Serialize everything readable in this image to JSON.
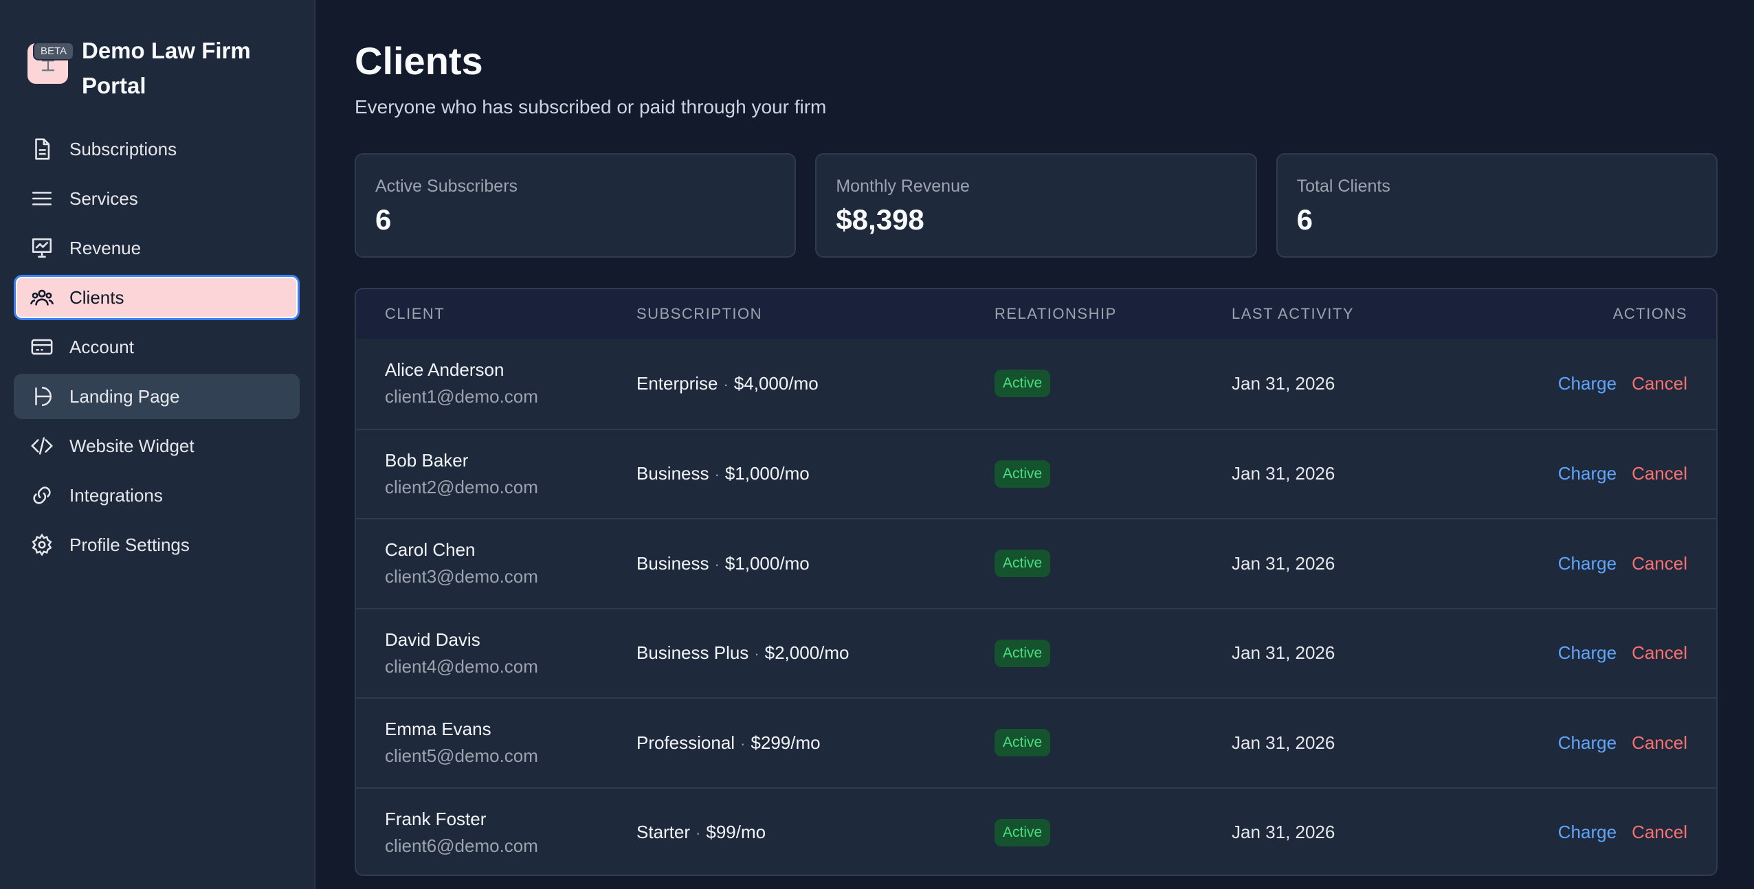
{
  "brand": {
    "title": "Demo Law Firm Portal",
    "badge": "BETA",
    "logo_icon": "scale-icon"
  },
  "sidebar": {
    "items": [
      {
        "label": "Subscriptions",
        "icon": "document-icon"
      },
      {
        "label": "Services",
        "icon": "list-icon"
      },
      {
        "label": "Revenue",
        "icon": "chart-presentation-icon"
      },
      {
        "label": "Clients",
        "icon": "users-icon",
        "active": true
      },
      {
        "label": "Account",
        "icon": "credit-card-icon"
      },
      {
        "label": "Landing Page",
        "icon": "landing-icon",
        "hover": true
      },
      {
        "label": "Website Widget",
        "icon": "code-icon"
      },
      {
        "label": "Integrations",
        "icon": "link-icon"
      },
      {
        "label": "Profile Settings",
        "icon": "gear-icon"
      }
    ]
  },
  "header": {
    "title": "Clients",
    "subtitle": "Everyone who has subscribed or paid through your firm"
  },
  "stats": [
    {
      "label": "Active Subscribers",
      "value": "6"
    },
    {
      "label": "Monthly Revenue",
      "value": "$8,398"
    },
    {
      "label": "Total Clients",
      "value": "6"
    }
  ],
  "table": {
    "columns": [
      "CLIENT",
      "SUBSCRIPTION",
      "RELATIONSHIP",
      "LAST ACTIVITY",
      "ACTIONS"
    ],
    "rows": [
      {
        "name": "Alice Anderson",
        "email": "client1@demo.com",
        "plan": "Enterprise",
        "price": "$4,000/mo",
        "status": "Active",
        "last_activity": "Jan 31, 2026",
        "charge": "Charge",
        "cancel": "Cancel"
      },
      {
        "name": "Bob Baker",
        "email": "client2@demo.com",
        "plan": "Business",
        "price": "$1,000/mo",
        "status": "Active",
        "last_activity": "Jan 31, 2026",
        "charge": "Charge",
        "cancel": "Cancel"
      },
      {
        "name": "Carol Chen",
        "email": "client3@demo.com",
        "plan": "Business",
        "price": "$1,000/mo",
        "status": "Active",
        "last_activity": "Jan 31, 2026",
        "charge": "Charge",
        "cancel": "Cancel"
      },
      {
        "name": "David Davis",
        "email": "client4@demo.com",
        "plan": "Business Plus",
        "price": "$2,000/mo",
        "status": "Active",
        "last_activity": "Jan 31, 2026",
        "charge": "Charge",
        "cancel": "Cancel"
      },
      {
        "name": "Emma Evans",
        "email": "client5@demo.com",
        "plan": "Professional",
        "price": "$299/mo",
        "status": "Active",
        "last_activity": "Jan 31, 2026",
        "charge": "Charge",
        "cancel": "Cancel"
      },
      {
        "name": "Frank Foster",
        "email": "client6@demo.com",
        "plan": "Starter",
        "price": "$99/mo",
        "status": "Active",
        "last_activity": "Jan 31, 2026",
        "charge": "Charge",
        "cancel": "Cancel"
      }
    ]
  },
  "colors": {
    "background": "#121a2b",
    "sidebar": "#1e293b",
    "active_nav": "#fbd5d8",
    "focus_ring": "#3b82f6",
    "charge_link": "#60a5fa",
    "cancel_link": "#f87171",
    "badge_text": "#4ade80",
    "badge_bg": "#14532d"
  }
}
